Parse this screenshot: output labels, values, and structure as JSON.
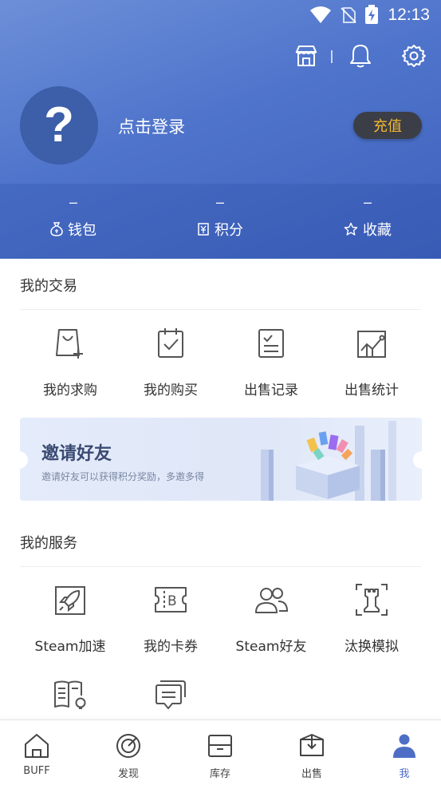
{
  "status_bar": {
    "time": "12:13"
  },
  "profile": {
    "avatar_glyph": "?",
    "login_text": "点击登录",
    "recharge_label": "充值"
  },
  "stats": [
    {
      "value": "–",
      "label": "钱包",
      "icon": "wallet-icon"
    },
    {
      "value": "–",
      "label": "积分",
      "icon": "points-icon"
    },
    {
      "value": "–",
      "label": "收藏",
      "icon": "star-icon"
    }
  ],
  "my_trades": {
    "title": "我的交易",
    "items": [
      {
        "label": "我的求购",
        "icon": "bag-plus-icon"
      },
      {
        "label": "我的购买",
        "icon": "clipboard-check-icon"
      },
      {
        "label": "出售记录",
        "icon": "list-check-icon"
      },
      {
        "label": "出售统计",
        "icon": "chart-icon"
      }
    ]
  },
  "invite_banner": {
    "title": "邀请好友",
    "subtitle": "邀请好友可以获得积分奖励，多邀多得"
  },
  "my_services": {
    "title": "我的服务",
    "items": [
      {
        "label": "Steam加速",
        "icon": "rocket-icon"
      },
      {
        "label": "我的卡券",
        "icon": "coupon-icon"
      },
      {
        "label": "Steam好友",
        "icon": "friends-icon"
      },
      {
        "label": "汰换模拟",
        "icon": "tower-icon"
      },
      {
        "label": "",
        "icon": "guide-book-icon"
      },
      {
        "label": "",
        "icon": "feedback-icon"
      }
    ]
  },
  "bottom_nav": [
    {
      "label": "BUFF",
      "icon": "home-icon"
    },
    {
      "label": "发现",
      "icon": "discover-icon"
    },
    {
      "label": "库存",
      "icon": "inventory-icon"
    },
    {
      "label": "出售",
      "icon": "sell-icon"
    },
    {
      "label": "我",
      "icon": "me-icon",
      "active": true
    }
  ],
  "colors": {
    "header_blue": "#4f74cb",
    "accent": "#4e6ec6",
    "recharge_text": "#f3b733"
  }
}
